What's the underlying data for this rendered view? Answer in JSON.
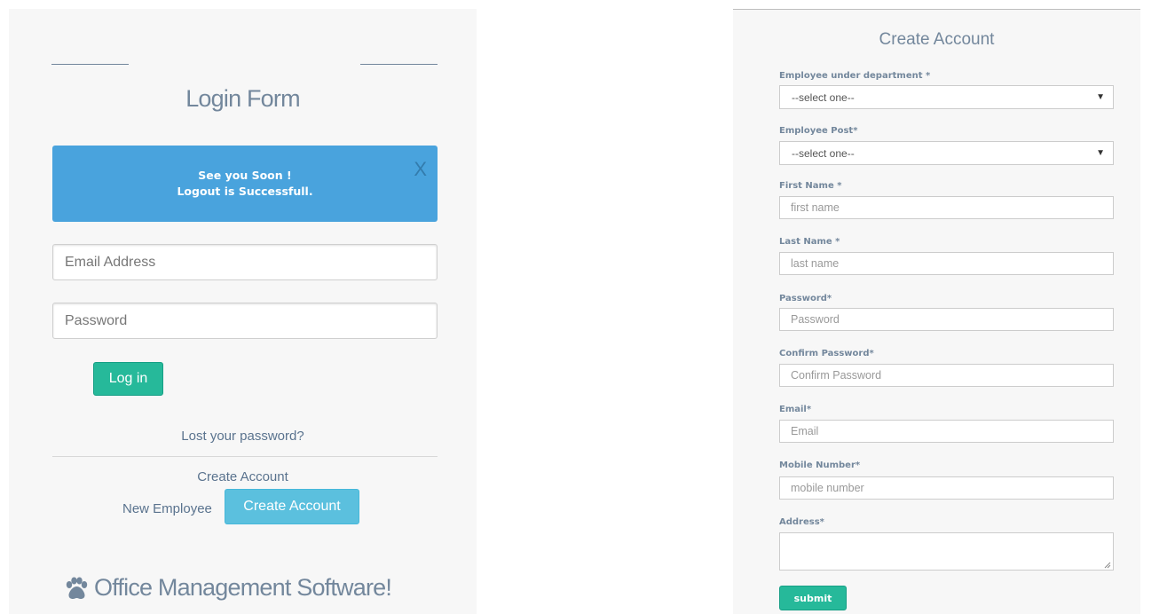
{
  "login": {
    "title": "Login Form",
    "alert": {
      "line1": "See you Soon !",
      "line2": "Logout is Successfull.",
      "close": "X"
    },
    "email_placeholder": "Email Address",
    "password_placeholder": "Password",
    "login_button": "Log in",
    "lost_password": "Lost your password?",
    "create_account_heading": "Create Account",
    "new_employee": "New Employee",
    "create_account_button": "Create Account",
    "brand": "Office Management Software!",
    "brand_icon": "paw-icon"
  },
  "create_account": {
    "title": "Create Account",
    "fields": [
      {
        "label": "Employee under department *",
        "type": "select",
        "value": "--select one--"
      },
      {
        "label": "Employee Post*",
        "type": "select",
        "value": "--select one--"
      },
      {
        "label": "First Name *",
        "type": "input",
        "placeholder": "first name"
      },
      {
        "label": "Last Name *",
        "type": "input",
        "placeholder": "last name"
      },
      {
        "label": "Password*",
        "type": "input",
        "placeholder": "Password"
      },
      {
        "label": "Confirm Password*",
        "type": "input",
        "placeholder": "Confirm Password"
      },
      {
        "label": "Email*",
        "type": "input",
        "placeholder": "Email"
      },
      {
        "label": "Mobile Number*",
        "type": "input",
        "placeholder": "mobile number"
      },
      {
        "label": "Address*",
        "type": "textarea",
        "placeholder": ""
      }
    ],
    "submit_button": "submit"
  },
  "colors": {
    "panel_bg": "#F7F7F7",
    "text": "#73879C",
    "alert_bg": "#49A3DD",
    "success": "#26B99A",
    "info": "#5BC0DE"
  }
}
